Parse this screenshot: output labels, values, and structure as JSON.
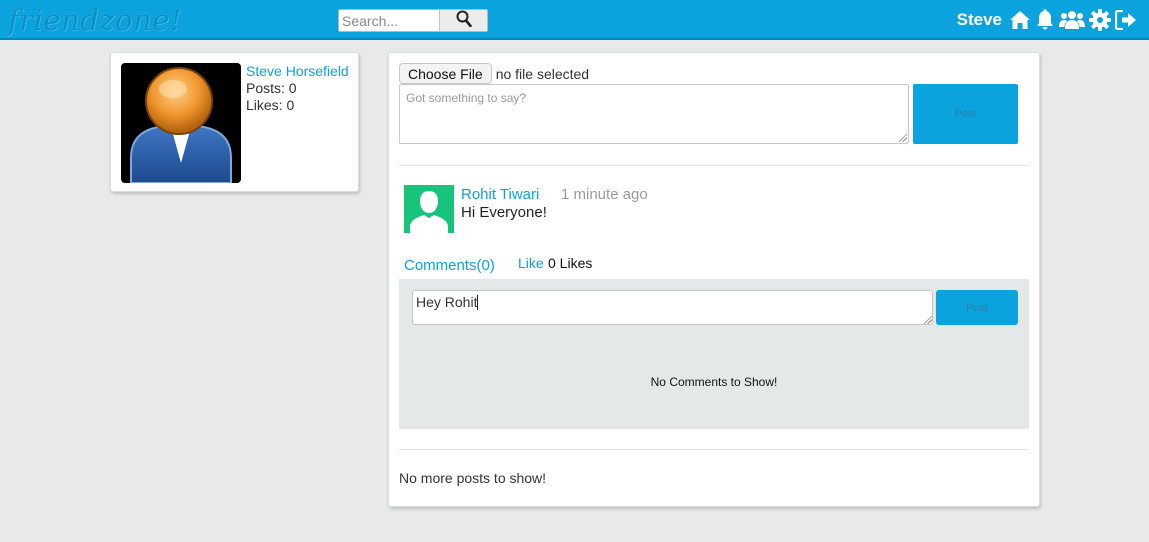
{
  "header": {
    "logo": "friendzone!",
    "search_placeholder": "Search...",
    "username": "Steve",
    "icons": [
      "search-icon",
      "home-icon",
      "bell-icon",
      "friends-icon",
      "gear-icon",
      "sign-out-icon"
    ]
  },
  "profile": {
    "name": "Steve Horsefield",
    "posts": "Posts: 0",
    "likes": "Likes: 0"
  },
  "composer": {
    "choose_file_label": "Choose File",
    "file_status": "no file selected",
    "placeholder": "Got something to say?",
    "post_label": "Post"
  },
  "post": {
    "author": "Rohit Tiwari",
    "time": "1 minute ago",
    "text": "Hi Everyone!",
    "comments_label": "Comments(0)",
    "like_label": "Like",
    "likes_count": "0 Likes",
    "comment_value": "Hey Rohit",
    "comment_post_label": "Post",
    "no_comments": "No Comments to Show!"
  },
  "footer": {
    "no_more_posts": "No more posts to show!"
  },
  "colors": {
    "accent": "#0aa3de",
    "page_bg": "#e8eaea",
    "avatar_green": "#17c47a"
  }
}
